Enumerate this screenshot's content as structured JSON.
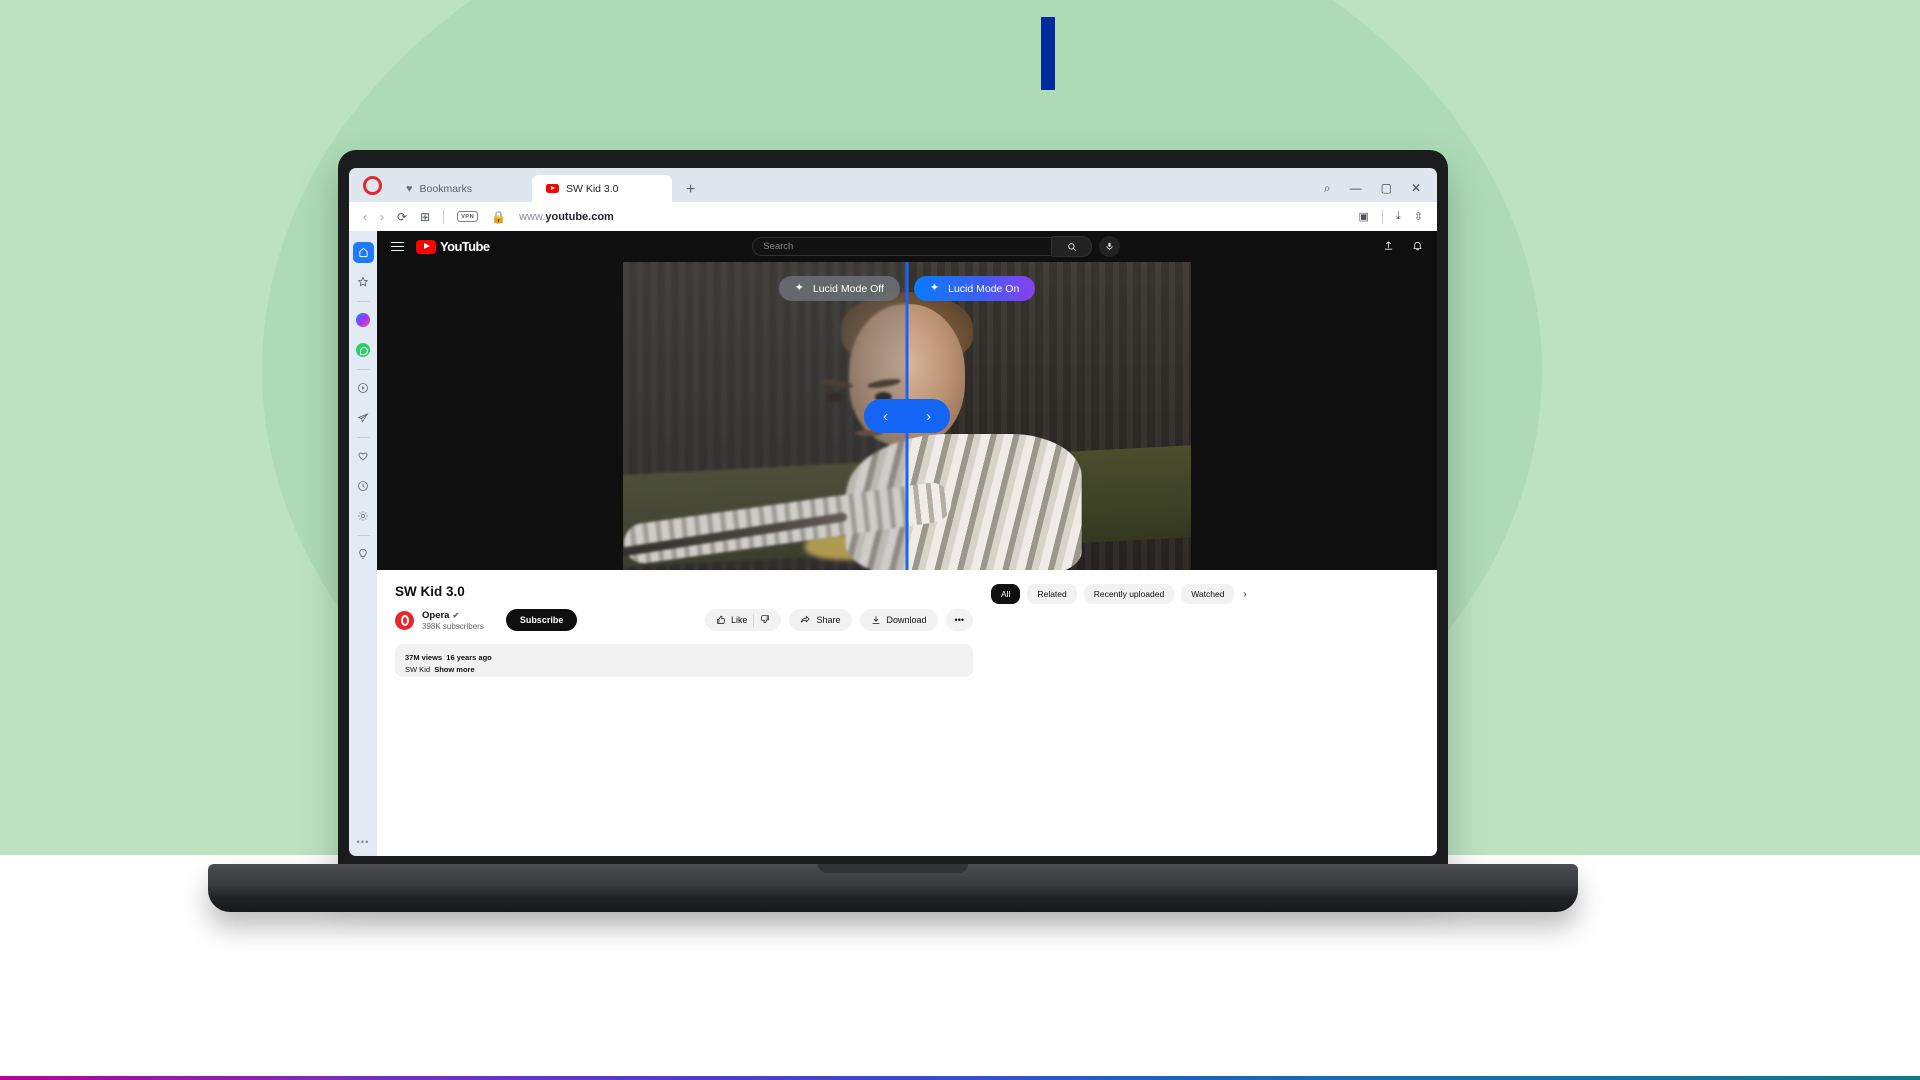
{
  "background": {
    "green": "#bce3c0",
    "ellipse": "#aedbb5",
    "accent_bar_color": "#002a9e"
  },
  "browser": {
    "app": "Opera",
    "bookmarks_label": "Bookmarks",
    "tab": {
      "title": "SW Kid 3.0",
      "favicon": "youtube-icon"
    },
    "new_tab_label": "+",
    "window_controls": {
      "search": "⌕",
      "minimize": "—",
      "maximize": "▢",
      "close": "✕"
    },
    "address_bar": {
      "back": "‹",
      "forward": "›",
      "reload": "⟳",
      "tab_islands": "⊞",
      "vpn_badge": "VPN",
      "lock": "🔒",
      "url_prefix": "www.",
      "url_domain": "youtube.com",
      "snapshot": "◙",
      "downloads": "⤓",
      "easy_setup": "⇳"
    }
  },
  "sidebar": {
    "items": [
      {
        "name": "home",
        "glyph": "⌂",
        "active": true
      },
      {
        "name": "favorites",
        "glyph": "☆",
        "active": false
      },
      {
        "name": "messenger",
        "glyph": "",
        "active": false
      },
      {
        "name": "whatsapp",
        "glyph": "",
        "active": false
      },
      {
        "name": "player",
        "glyph": "◉",
        "active": false
      },
      {
        "name": "telegram",
        "glyph": "➤",
        "active": false
      },
      {
        "name": "pinboards",
        "glyph": "♡",
        "active": false
      },
      {
        "name": "history",
        "glyph": "🕑",
        "active": false
      },
      {
        "name": "settings",
        "glyph": "⚙",
        "active": false
      },
      {
        "name": "tips",
        "glyph": "💡",
        "active": false
      }
    ],
    "more_label": "•••"
  },
  "youtube": {
    "header": {
      "menu": "☰",
      "logo_text": "YouTube",
      "search_placeholder": "Search",
      "search_value": "",
      "search_button": "⌕",
      "mic": "🎤",
      "upload": "⬆",
      "notifications": "🔔"
    },
    "video": {
      "lucid_off_label": "Lucid Mode Off",
      "lucid_on_label": "Lucid Mode On",
      "sparkle_icon": "✦",
      "slider_prev": "‹",
      "slider_next": "›",
      "split_color": "#1d63f3",
      "lucid_on_gradient_start": "#0a7bff",
      "lucid_on_gradient_end": "#8a3ff0"
    },
    "info": {
      "title": "SW Kid 3.0",
      "channel_name": "Opera",
      "verified_badge": "✔",
      "subscribers": "398K subscribers",
      "subscribe_label": "Subscribe",
      "like_label": "Like",
      "like_icon": "like-icon",
      "dislike_icon": "dislike-icon",
      "share_label": "Share",
      "download_label": "Download",
      "more_label": "•••",
      "views": "37M views",
      "published": "16 years ago",
      "description_tag": "SW Kid",
      "show_more_label": "Show more"
    },
    "filters": {
      "chips": [
        "All",
        "Related",
        "Recently uploaded",
        "Watched"
      ],
      "active_index": 0,
      "next_label": "›"
    }
  }
}
